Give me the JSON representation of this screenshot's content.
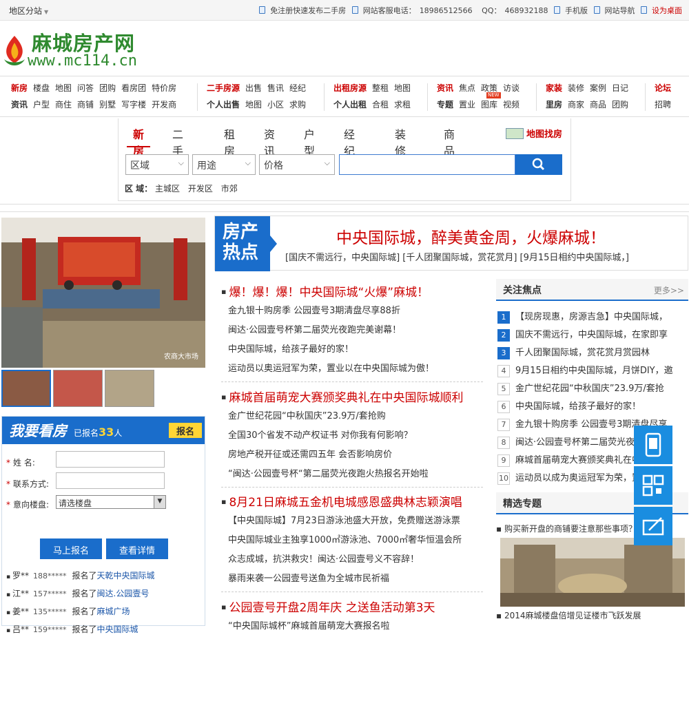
{
  "topbar": {
    "region": "地区分站",
    "links": {
      "publish": "免注册快速发布二手房",
      "hotline_label": "网站客服电话：",
      "hotline": "18986512566",
      "qq_label": "QQ：",
      "qq": "468932188",
      "mobile": "手机版",
      "sitenav": "网站导航",
      "set_home": "设为桌面"
    }
  },
  "logo": {
    "cn": "麻城房产网",
    "url": "www.mc114.cn"
  },
  "nav": {
    "g1": {
      "row1": [
        {
          "t": "新房",
          "red": true
        },
        {
          "t": "楼盘"
        },
        {
          "t": "地图"
        },
        {
          "t": "问答"
        },
        {
          "t": "团购"
        },
        {
          "t": "看房团"
        },
        {
          "t": "特价房"
        }
      ],
      "row2": [
        {
          "t": "资讯",
          "hd": true
        },
        {
          "t": "户型"
        },
        {
          "t": "商住"
        },
        {
          "t": "商铺"
        },
        {
          "t": "别墅"
        },
        {
          "t": "写字楼"
        },
        {
          "t": "开发商"
        }
      ]
    },
    "g2": {
      "row1": [
        {
          "t": "二手房源",
          "red": true
        },
        {
          "t": "出售"
        },
        {
          "t": "售讯"
        },
        {
          "t": "经纪"
        }
      ],
      "row2": [
        {
          "t": "个人出售",
          "hd": true
        },
        {
          "t": "地图"
        },
        {
          "t": "小区"
        },
        {
          "t": "求购"
        }
      ]
    },
    "g3": {
      "row1": [
        {
          "t": "出租房源",
          "red": true
        },
        {
          "t": "整租"
        },
        {
          "t": "地图"
        }
      ],
      "row2": [
        {
          "t": "个人出租",
          "hd": true
        },
        {
          "t": "合租"
        },
        {
          "t": "求租"
        }
      ]
    },
    "g4": {
      "row1": [
        {
          "t": "资讯",
          "red": true
        },
        {
          "t": "焦点"
        },
        {
          "t": "政策"
        },
        {
          "t": "访谈"
        }
      ],
      "row2": [
        {
          "t": "专题",
          "hd": true
        },
        {
          "t": "置业"
        },
        {
          "t": "图库"
        },
        {
          "t": "视频"
        }
      ],
      "new_badge": "NEW"
    },
    "g5": {
      "row1": [
        {
          "t": "家装",
          "red": true
        },
        {
          "t": "装修"
        },
        {
          "t": "案例"
        },
        {
          "t": "日记"
        }
      ],
      "row2": [
        {
          "t": "里房",
          "hd": true
        },
        {
          "t": "商家"
        },
        {
          "t": "商品"
        },
        {
          "t": "团购"
        }
      ]
    },
    "g6": {
      "row1": [
        {
          "t": "论坛",
          "red": true
        }
      ],
      "row2": [
        {
          "t": "招聘"
        }
      ]
    }
  },
  "search": {
    "tabs": [
      "新房",
      "二手房",
      "租房",
      "资讯",
      "户型",
      "经纪人",
      "装修",
      "商品"
    ],
    "active_tab": "新房",
    "map_link": "地图找房",
    "selects": {
      "area": "区域",
      "use": "用途",
      "price": "价格"
    },
    "area_filter_label": "区  域：",
    "area_filter": [
      "主城区",
      "开发区",
      "市郊"
    ]
  },
  "photo": {
    "watermark": "农商大市场"
  },
  "signup": {
    "title": "我要看房",
    "count_prefix": "已报名",
    "count": "33",
    "count_suffix": "人",
    "register": "报名",
    "name_label": "姓    名:",
    "phone_label": "联系方式:",
    "estate_label": "意向楼盘:",
    "estate_default": "请选楼盘",
    "submit": "马上报名",
    "details": "查看详情",
    "list": [
      {
        "name": "罗**",
        "phone": "188*****",
        "action": "报名了",
        "estate": "天乾中央国际城"
      },
      {
        "name": "江**",
        "phone": "157*****",
        "action": "报名了",
        "estate": "闽达.公园壹号"
      },
      {
        "name": "姜**",
        "phone": "135*****",
        "action": "报名了",
        "estate": "麻城广场"
      },
      {
        "name": "吕**",
        "phone": "159*****",
        "action": "报名了",
        "estate": "中央国际城"
      }
    ]
  },
  "hot": {
    "badge": "房产热点",
    "headline": "中央国际城，醉美黄金周，火爆麻城！",
    "sub": "[国庆不需远行，中央国际城] [千人团聚国际城，赏花赏月] [9月15日相约中央国际城，]"
  },
  "news": [
    {
      "title": "爆！爆！爆！中央国际城“火爆”麻城！",
      "items": [
        "金九银十购房季 公园壹号3期清盘尽享88折",
        "闽达·公园壹号杯第二届荧光夜跑完美谢幕！",
        "中央国际城，给孩子最好的家！",
        "运动员以奥运冠军为荣，置业以在中央国际城为傲！"
      ]
    },
    {
      "title": "麻城首届萌宠大赛颁奖典礼在中央国际城顺利",
      "items": [
        "金广世纪花园“中秋国庆”23.9万/套抢购",
        "全国30个省发不动产权证书 对你我有何影响？",
        "房地产税开征或还需四五年 会否影响房价",
        "“闽达·公园壹号杯“第二届荧光夜跑火热报名开始啦"
      ]
    },
    {
      "title": "8月21日麻城五金机电城感恩盛典林志颖演唱",
      "items": [
        "【中央国际城】7月23日游泳池盛大开放，免费赠送游泳票",
        "中央国际城业主独享1000㎡游泳池、7000㎡奢华恒温会所",
        "众志成城，抗洪救灾！闽达·公园壹号义不容辞！",
        "暴雨来袭一公园壹号送鱼为全城市民祈福"
      ]
    },
    {
      "title": "公园壹号开盘2周年庆 之送鱼活动第3天",
      "items": [
        "“中央国际城杯”麻城首届萌宠大赛报名啦"
      ]
    }
  ],
  "focus": {
    "title": "关注焦点",
    "more": "更多>>",
    "items": [
      "【现房现惠，房源吉急】中央国际城，",
      "国庆不需远行，中央国际城，在家即享",
      "千人团聚国际城，赏花赏月赏园林",
      "9月15日相约中央国际城，月饼DIY，邀",
      "金广世纪花园“中秋国庆”23.9万/套抢",
      "中央国际城，给孩子最好的家！",
      "金九银十购房季 公园壹号3期清盘尽享",
      "闽达·公园壹号杯第二届荧光夜跑完美",
      "麻城首届萌宠大赛颁奖典礼在中央国际",
      "运动员以成为奥运冠军为荣，置业以"
    ]
  },
  "topics": {
    "title": "精选专题",
    "q": "购买新开盘的商铺要注意那些事项？",
    "caption": "2014麻城楼盘倍增见证楼市飞跃发展"
  },
  "colors": {
    "brand_blue": "#1a6dcb",
    "red": "#cc0000",
    "logo_green": "#2f8a2f"
  }
}
